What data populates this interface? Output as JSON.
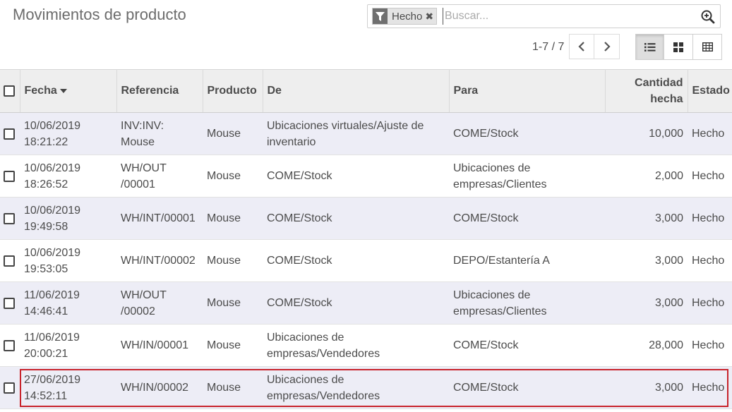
{
  "page": {
    "title": "Movimientos de producto"
  },
  "search": {
    "facet_label": "Hecho",
    "placeholder": "Buscar..."
  },
  "pager": {
    "value": "1-7 / 7"
  },
  "table": {
    "columns": [
      "Fecha",
      "Referencia",
      "Producto",
      "De",
      "Para",
      "Cantidad hecha",
      "Estado"
    ],
    "column_quantity_line1": "Cantidad",
    "column_quantity_line2": "hecha",
    "rows": [
      {
        "fecha_d": "10/06/2019",
        "fecha_t": "18:21:22",
        "ref1": "INV:INV:",
        "ref2": "Mouse",
        "producto": "Mouse",
        "de1": "Ubicaciones virtuales/Ajuste de",
        "de2": "inventario",
        "para1": "COME/Stock",
        "para2": "",
        "cantidad": "10,000",
        "estado": "Hecho"
      },
      {
        "fecha_d": "10/06/2019",
        "fecha_t": "18:26:52",
        "ref1": "WH/OUT",
        "ref2": "/00001",
        "producto": "Mouse",
        "de1": "COME/Stock",
        "de2": "",
        "para1": "Ubicaciones de",
        "para2": "empresas/Clientes",
        "cantidad": "2,000",
        "estado": "Hecho"
      },
      {
        "fecha_d": "10/06/2019",
        "fecha_t": "19:49:58",
        "ref1": "WH/INT/00001",
        "ref2": "",
        "producto": "Mouse",
        "de1": "COME/Stock",
        "de2": "",
        "para1": "COME/Stock",
        "para2": "",
        "cantidad": "3,000",
        "estado": "Hecho"
      },
      {
        "fecha_d": "10/06/2019",
        "fecha_t": "19:53:05",
        "ref1": "WH/INT/00002",
        "ref2": "",
        "producto": "Mouse",
        "de1": "COME/Stock",
        "de2": "",
        "para1": "DEPO/Estantería A",
        "para2": "",
        "cantidad": "3,000",
        "estado": "Hecho"
      },
      {
        "fecha_d": "11/06/2019",
        "fecha_t": "14:46:41",
        "ref1": "WH/OUT",
        "ref2": "/00002",
        "producto": "Mouse",
        "de1": "COME/Stock",
        "de2": "",
        "para1": "Ubicaciones de",
        "para2": "empresas/Clientes",
        "cantidad": "3,000",
        "estado": "Hecho"
      },
      {
        "fecha_d": "11/06/2019",
        "fecha_t": "20:00:21",
        "ref1": "WH/IN/00001",
        "ref2": "",
        "producto": "Mouse",
        "de1": "Ubicaciones de",
        "de2": "empresas/Vendedores",
        "para1": "COME/Stock",
        "para2": "",
        "cantidad": "28,000",
        "estado": "Hecho"
      },
      {
        "fecha_d": "27/06/2019",
        "fecha_t": "14:52:11",
        "ref1": "WH/IN/00002",
        "ref2": "",
        "producto": "Mouse",
        "de1": "Ubicaciones de",
        "de2": "empresas/Vendedores",
        "para1": "COME/Stock",
        "para2": "",
        "cantidad": "3,000",
        "estado": "Hecho"
      }
    ]
  },
  "colors": {
    "odd_row": "#ededf6",
    "highlight": "#c8232b",
    "header_bg": "#eeeeee"
  },
  "icons": {
    "facet": "filter-icon",
    "facet_remove": "close-icon",
    "search": "search-zoom-icon",
    "prev": "chevron-left-icon",
    "next": "chevron-right-icon",
    "list_view": "list-view-icon",
    "kanban_view": "kanban-view-icon",
    "pivot_view": "pivot-view-icon",
    "sort": "caret-down-icon"
  }
}
